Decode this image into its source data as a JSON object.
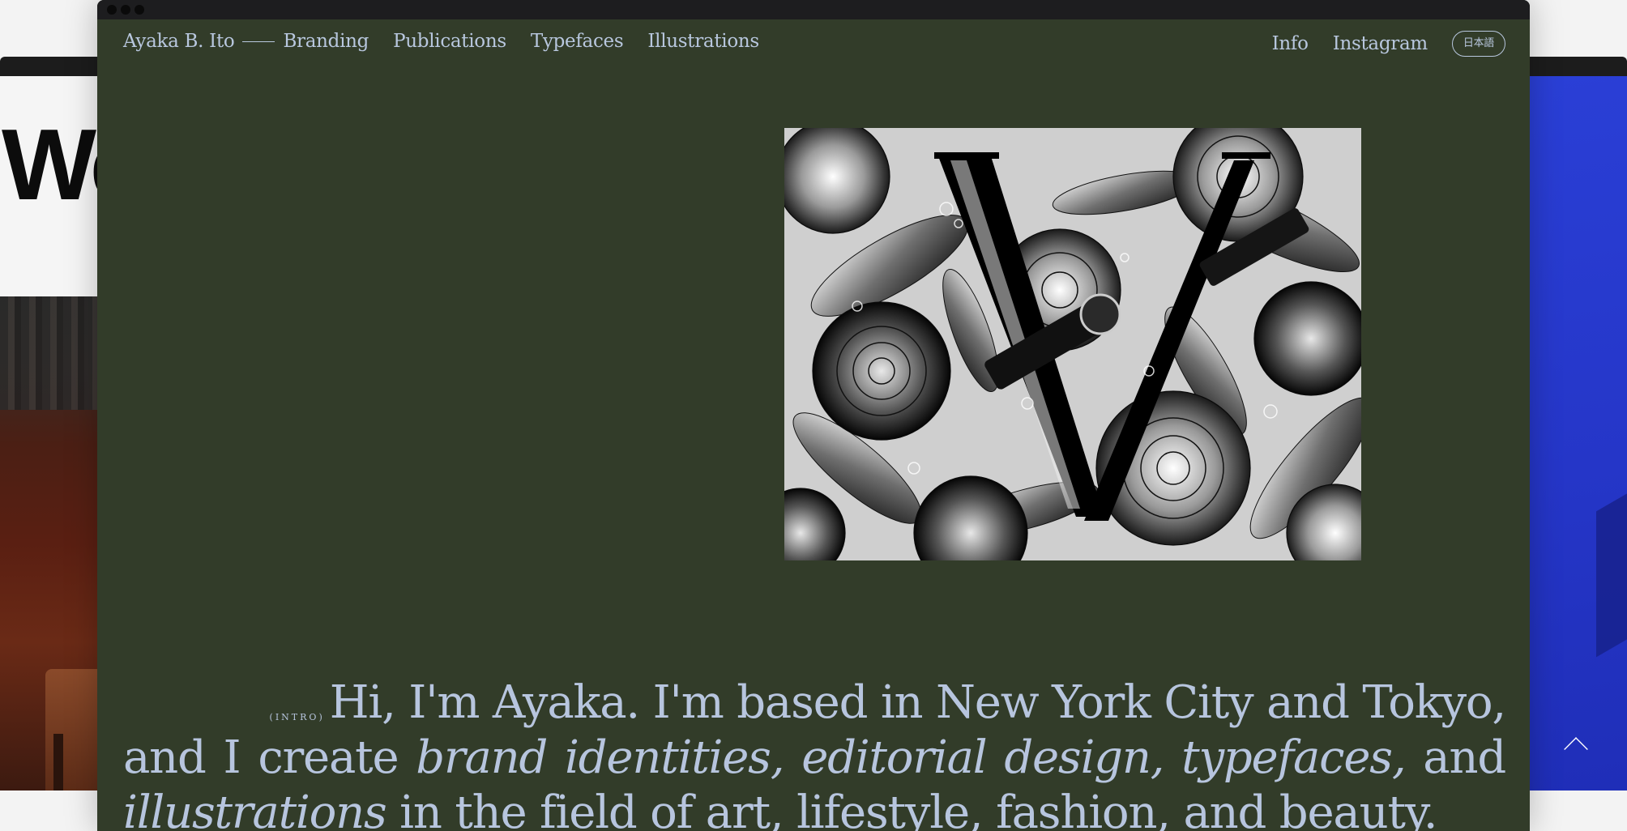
{
  "background_windows": {
    "left_partial_heading": "We"
  },
  "site": {
    "owner_name": "Ayaka B. Ito",
    "nav_left": [
      {
        "label": "Branding"
      },
      {
        "label": "Publications"
      },
      {
        "label": "Typefaces"
      },
      {
        "label": "Illustrations"
      }
    ],
    "nav_right": {
      "info": "Info",
      "instagram": "Instagram",
      "language": "日本語"
    }
  },
  "intro": {
    "tag": "(INTRO)",
    "line1": "Hi, I'm Ayaka. I'm based in New York City and Tokyo,",
    "and_i_create": "and I create",
    "brand_identities": "brand identities,",
    "editorial_design": "editorial design,",
    "typefaces": "typefaces,",
    "and": "and",
    "illustrations": "illustrations",
    "tail": "in the field of art, lifestyle, fashion, and beauty."
  },
  "colors": {
    "window_background": "#323c29",
    "text": "#b7c5de",
    "underline": "#a8a248",
    "right_window_blue": "#2536c8"
  },
  "icons": {
    "scroll_top": "chevron-up-icon"
  }
}
